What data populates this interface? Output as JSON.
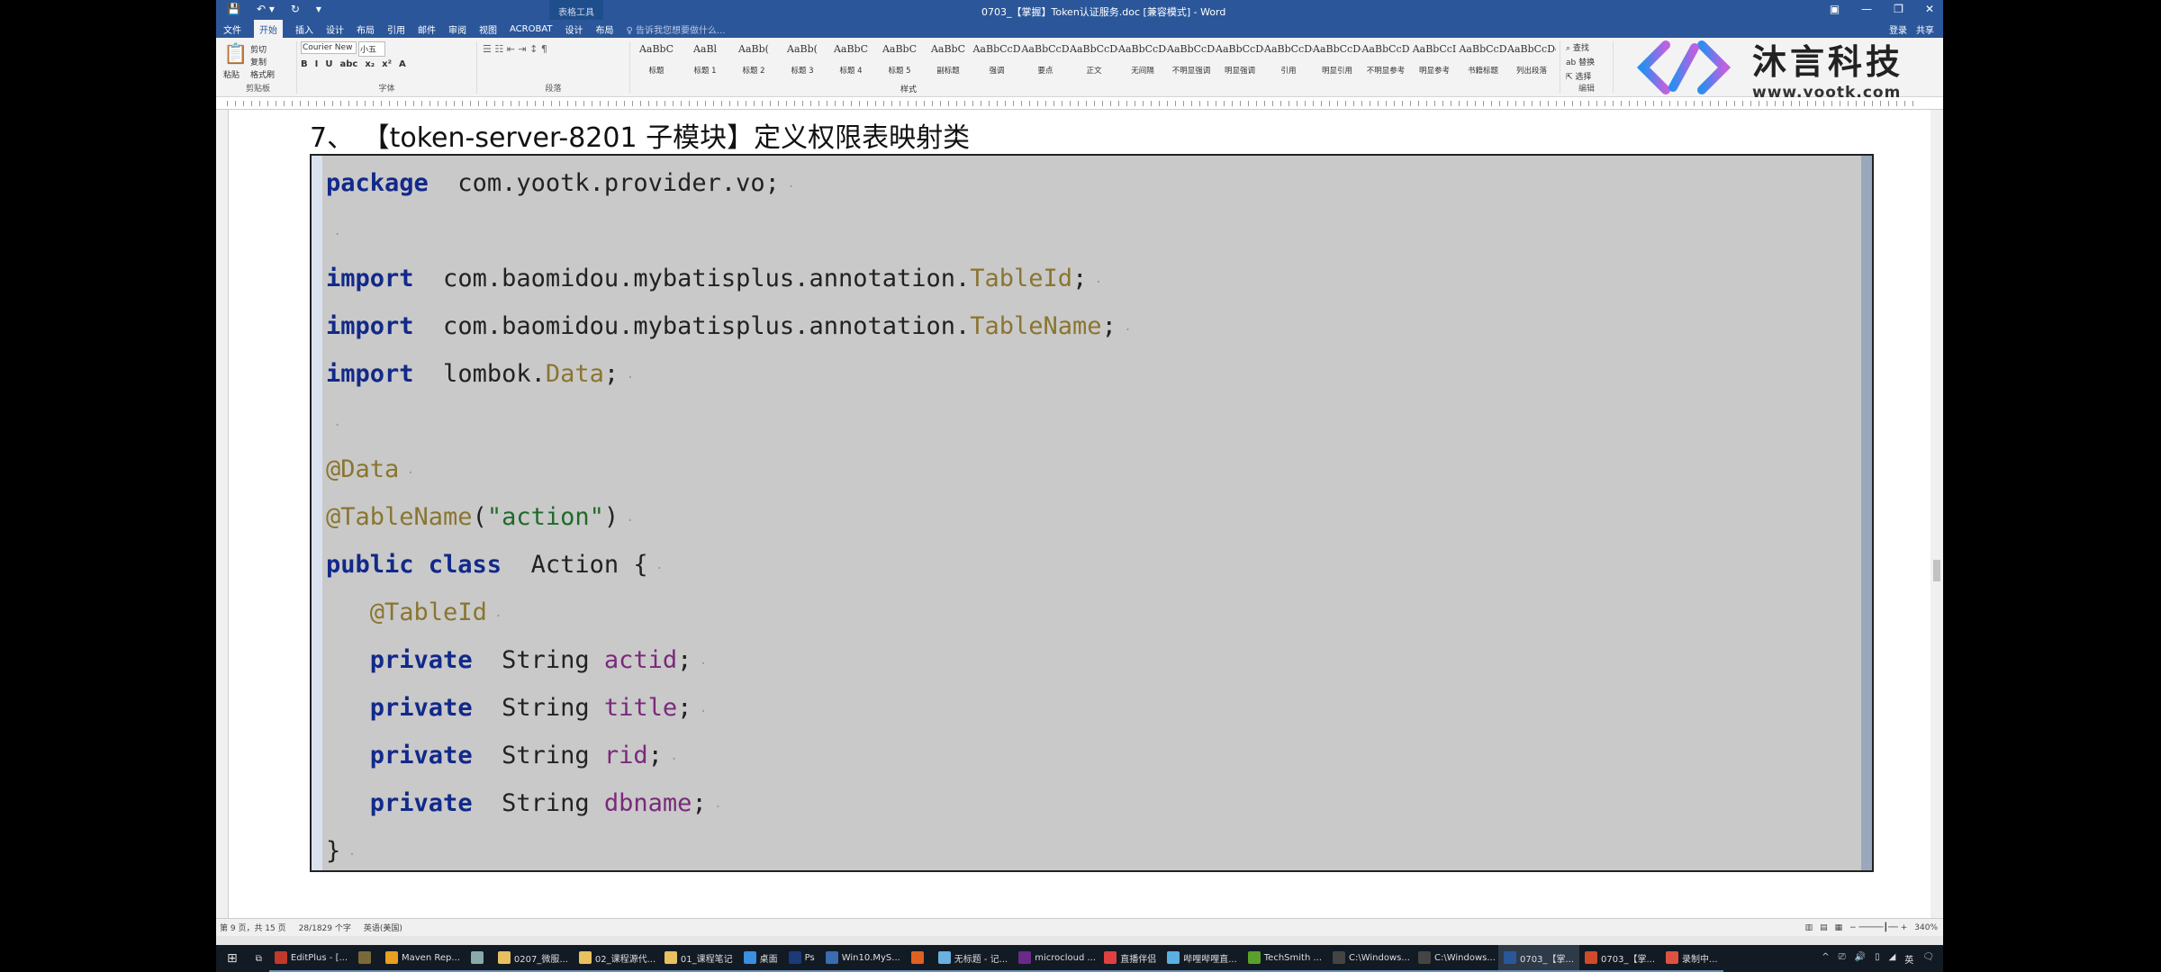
{
  "window": {
    "title": "0703_【掌握】Token认证服务.doc [兼容模式] - Word",
    "context_tab": "表格工具",
    "controls": [
      "▣",
      "—",
      "❐",
      "✕"
    ]
  },
  "quick_access": [
    "💾",
    "↶ ▾",
    "↻",
    "▾"
  ],
  "tabs": [
    "文件",
    "开始",
    "插入",
    "设计",
    "布局",
    "引用",
    "邮件",
    "审阅",
    "视图",
    "ACROBAT",
    "设计",
    "布局"
  ],
  "active_tab": 1,
  "tell_me": "♀ 告诉我您想要做什么...",
  "account": {
    "login": "登录",
    "share": "共享"
  },
  "ribbon": {
    "clipboard": {
      "paste": "粘贴",
      "cut": "剪切",
      "copy": "复制",
      "format_painter": "格式刷",
      "label": "剪贴板"
    },
    "font": {
      "name": "Courier New",
      "size": "小五",
      "label": "字体",
      "buttons": [
        "B",
        "I",
        "U",
        "abc",
        "x₂",
        "x²",
        "A"
      ]
    },
    "paragraph": {
      "label": "段落"
    },
    "styles": {
      "label": "样式",
      "items": [
        {
          "pv": "AaBbC",
          "nm": "标题"
        },
        {
          "pv": "AaBl",
          "nm": "标题 1"
        },
        {
          "pv": "AaBb(",
          "nm": "标题 2"
        },
        {
          "pv": "AaBb(",
          "nm": "标题 3"
        },
        {
          "pv": "AaBbC",
          "nm": "标题 4"
        },
        {
          "pv": "AaBbC",
          "nm": "标题 5"
        },
        {
          "pv": "AaBbC",
          "nm": "副标题"
        },
        {
          "pv": "AaBbCcD",
          "nm": "强调"
        },
        {
          "pv": "AaBbCcD",
          "nm": "要点"
        },
        {
          "pv": "AaBbCcDc",
          "nm": "正文"
        },
        {
          "pv": "AaBbCcDc",
          "nm": "无间隔"
        },
        {
          "pv": "AaBbCcDc",
          "nm": "不明显强调"
        },
        {
          "pv": "AaBbCcDc",
          "nm": "明显强调"
        },
        {
          "pv": "AaBbCcDc",
          "nm": "引用"
        },
        {
          "pv": "AaBbCcDc",
          "nm": "明显引用"
        },
        {
          "pv": "AaBbCcD",
          "nm": "不明显参考"
        },
        {
          "pv": "AaBbCcI",
          "nm": "明显参考"
        },
        {
          "pv": "AaBbCcD",
          "nm": "书籍标题"
        },
        {
          "pv": "AaBbCcDc",
          "nm": "列出段落"
        }
      ]
    },
    "editing": {
      "find": "查找",
      "replace": "替换",
      "select": "选择",
      "label": "编辑"
    }
  },
  "logo": {
    "name": "沐言科技",
    "url": "www.yootk.com"
  },
  "document": {
    "heading": "7、   【token-server-8201 子模块】定义权限表映射类",
    "code_lines": [
      [
        [
          "kw",
          "package"
        ],
        [
          "",
          "  com.yootk.provider.vo;"
        ]
      ],
      [],
      [
        [
          "kw",
          "import"
        ],
        [
          "",
          "  com.baomidou.mybatisplus.annotation."
        ],
        [
          "an",
          "TableId"
        ],
        [
          "",
          ";"
        ]
      ],
      [
        [
          "kw",
          "import"
        ],
        [
          "",
          "  com.baomidou.mybatisplus.annotation."
        ],
        [
          "an",
          "TableName"
        ],
        [
          "",
          ";"
        ]
      ],
      [
        [
          "kw",
          "import"
        ],
        [
          "",
          "  lombok."
        ],
        [
          "an",
          "Data"
        ],
        [
          "",
          ";"
        ]
      ],
      [],
      [
        [
          "an",
          "@Data"
        ]
      ],
      [
        [
          "an",
          "@TableName"
        ],
        [
          "",
          "("
        ],
        [
          "st",
          "\"action\""
        ],
        [
          "",
          ")"
        ]
      ],
      [
        [
          "kw",
          "public class"
        ],
        [
          "",
          "  Action {"
        ]
      ],
      [
        [
          "",
          "   "
        ],
        [
          "an",
          "@TableId"
        ]
      ],
      [
        [
          "",
          "   "
        ],
        [
          "kw",
          "private"
        ],
        [
          "",
          "  String "
        ],
        [
          "fd",
          "actid"
        ],
        [
          "",
          ";"
        ]
      ],
      [
        [
          "",
          "   "
        ],
        [
          "kw",
          "private"
        ],
        [
          "",
          "  String "
        ],
        [
          "fd",
          "title"
        ],
        [
          "",
          ";"
        ]
      ],
      [
        [
          "",
          "   "
        ],
        [
          "kw",
          "private"
        ],
        [
          "",
          "  String "
        ],
        [
          "fd",
          "rid"
        ],
        [
          "",
          ";"
        ]
      ],
      [
        [
          "",
          "   "
        ],
        [
          "kw",
          "private"
        ],
        [
          "",
          "  String "
        ],
        [
          "fd",
          "dbname"
        ],
        [
          "",
          ";"
        ]
      ],
      [
        [
          "",
          "}"
        ]
      ]
    ]
  },
  "status": {
    "page": "第 9 页，共 15 页",
    "words": "28/1829 个字",
    "language": "英语(美国)",
    "zoom": "340%"
  },
  "taskbar": {
    "items": [
      {
        "label": "EditPlus - [...",
        "color": "#c0392b"
      },
      {
        "label": "",
        "color": "#7a6a3a"
      },
      {
        "label": "Maven Rep...",
        "color": "#e8a020"
      },
      {
        "label": "",
        "color": "#8aa"
      },
      {
        "label": "0207_微服...",
        "color": "#e8c060"
      },
      {
        "label": "02_课程源代...",
        "color": "#e8c060"
      },
      {
        "label": "01_课程笔记",
        "color": "#e8c060"
      },
      {
        "label": "桌面",
        "color": "#3b8ee0"
      },
      {
        "label": "Ps",
        "color": "#1b3a7a"
      },
      {
        "label": "Win10.MyS...",
        "color": "#3b6bb0"
      },
      {
        "label": "",
        "color": "#e06020"
      },
      {
        "label": "无标题 - 记...",
        "color": "#6ab0e0"
      },
      {
        "label": "microcloud ...",
        "color": "#6a2a8a"
      },
      {
        "label": "直播伴侣",
        "color": "#e04040"
      },
      {
        "label": "哔哩哔哩直...",
        "color": "#5ab0e0"
      },
      {
        "label": "TechSmith ...",
        "color": "#5aa02a"
      },
      {
        "label": "C:\\Windows...",
        "color": "#444"
      },
      {
        "label": "C:\\Windows...",
        "color": "#444"
      },
      {
        "label": "0703_【掌...",
        "color": "#2b579a",
        "active": true
      },
      {
        "label": "0703_【掌...",
        "color": "#d04a2a"
      },
      {
        "label": "录制中...",
        "color": "#e05040"
      }
    ],
    "tray": [
      "^",
      "⎚",
      "🔊",
      "▯",
      "◢",
      "英",
      "🗨"
    ]
  }
}
